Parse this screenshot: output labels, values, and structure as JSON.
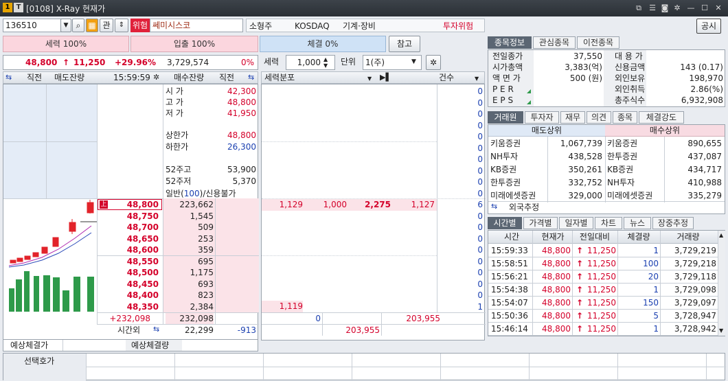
{
  "window": {
    "badge1": "1",
    "badge2": "T",
    "title": "[0108] X-Ray 현재가"
  },
  "toolbar": {
    "code": "136510",
    "gwan": "관",
    "warn_badge": "위험",
    "stock_name": "쎄미시스코",
    "gongsi": "공시"
  },
  "info": {
    "size": "소형주",
    "market": "KOSDAQ",
    "sector": "기계·장비",
    "risk": "투자위험"
  },
  "bars": {
    "sell_strength": "세력 100%",
    "inflow": "입출 100%",
    "exec": "체결 0%",
    "ref_btn": "참고"
  },
  "price": {
    "current": "48,800",
    "arrow": "↑",
    "change": "11,250",
    "rate": "+29.96%",
    "volume": "3,729,574",
    "pct": "0%"
  },
  "controls": {
    "label_force": "세력",
    "force_val": "1,000",
    "label_unit": "단위",
    "unit_val": "1(주)"
  },
  "book_header": {
    "c1": "직전",
    "c2": "매도잔량",
    "time": "15:59:59",
    "c3": "매수잔량",
    "c4": "직전"
  },
  "mid_header": {
    "force_dist": "세력분포",
    "count": "건수"
  },
  "info_labels": [
    {
      "label": "시 가",
      "value": "42,300"
    },
    {
      "label": "고 가",
      "value": "48,800"
    },
    {
      "label": "저 가",
      "value": "41,950"
    },
    {
      "label": "상한가",
      "value": "48,800"
    },
    {
      "label": "하한가",
      "value": "26,300"
    },
    {
      "label": "52주고",
      "value": "53,900"
    },
    {
      "label": "52주저",
      "value": "5,370"
    }
  ],
  "credit": {
    "prefix": "일반(",
    "val": "100",
    "suffix": ")/신용불가"
  },
  "bid_rows": [
    {
      "price": "48,800",
      "qty": "223,662"
    },
    {
      "price": "48,750",
      "qty": "1,545"
    },
    {
      "price": "48,700",
      "qty": "509"
    },
    {
      "price": "48,650",
      "qty": "253"
    },
    {
      "price": "48,600",
      "qty": "359"
    },
    {
      "price": "48,550",
      "qty": "695"
    },
    {
      "price": "48,500",
      "qty": "1,175"
    },
    {
      "price": "48,450",
      "qty": "693"
    },
    {
      "price": "48,400",
      "qty": "823"
    },
    {
      "price": "48,350",
      "qty": "2,384"
    }
  ],
  "upper_badge": "上",
  "totals": {
    "diff": "+232,098",
    "buy_total": "232,098",
    "after_label": "시간외",
    "after_qty": "22,299",
    "after_diff": "-913"
  },
  "force_row1": {
    "a": "1,129",
    "b": "1,000",
    "c": "2,275",
    "d": "1,127",
    "cnt": "6"
  },
  "force_row_last": {
    "a": "1,119",
    "cnt": "1"
  },
  "count_zero": "0",
  "force_totals": {
    "left": "0",
    "right": "203,955",
    "bottom": "203,955"
  },
  "expect": {
    "price_label": "예상체결가",
    "qty_label": "예상체결량"
  },
  "bottom": {
    "select_label": "선택호가"
  },
  "right_tabs1": [
    "종목정보",
    "관심종목",
    "이전종목"
  ],
  "stock_info": [
    {
      "l": "전일종가",
      "v": "37,550",
      "l2": "대 용 가",
      "v2": ""
    },
    {
      "l": "시가총액",
      "v": "3,383(억)",
      "l2": "신용금액",
      "v2": "143  (0.17)"
    },
    {
      "l": "액 면 가",
      "v": "500 (원)",
      "l2": "외인보유",
      "v2": "198,970"
    },
    {
      "l": "P E R",
      "v": "",
      "l2": "외인취득",
      "v2": "2.86(%)"
    },
    {
      "l": "E P S",
      "v": "",
      "l2": "총주식수",
      "v2": "6,932,908"
    }
  ],
  "right_tabs2": [
    "거래원",
    "투자자",
    "재무",
    "의견",
    "종목",
    "체결강도"
  ],
  "broker_header": {
    "sell": "매도상위",
    "buy": "매수상위"
  },
  "brokers": [
    {
      "s": "키움증권",
      "sq": "1,067,739",
      "b": "키움증권",
      "bq": "890,655"
    },
    {
      "s": "NH투자",
      "sq": "438,528",
      "b": "한투증권",
      "bq": "437,087"
    },
    {
      "s": "KB증권",
      "sq": "350,261",
      "b": "KB증권",
      "bq": "434,717"
    },
    {
      "s": "한투증권",
      "sq": "332,752",
      "b": "NH투자",
      "bq": "410,988"
    },
    {
      "s": "미래에셋증권",
      "sq": "329,000",
      "b": "미래에셋증권",
      "bq": "335,279"
    }
  ],
  "foreign_est": "외국추정",
  "right_tabs3": [
    "시간별",
    "가격별",
    "일자별",
    "차트",
    "뉴스",
    "장중추정"
  ],
  "trades_header": [
    "시간",
    "현재가",
    "전일대비",
    "체결량",
    "거래량"
  ],
  "trades": [
    {
      "t": "15:59:33",
      "p": "48,800",
      "d": "11,250",
      "q": "1",
      "v": "3,729,219"
    },
    {
      "t": "15:58:51",
      "p": "48,800",
      "d": "11,250",
      "q": "100",
      "v": "3,729,218"
    },
    {
      "t": "15:56:21",
      "p": "48,800",
      "d": "11,250",
      "q": "20",
      "v": "3,729,118"
    },
    {
      "t": "15:54:38",
      "p": "48,800",
      "d": "11,250",
      "q": "1",
      "v": "3,729,098"
    },
    {
      "t": "15:54:07",
      "p": "48,800",
      "d": "11,250",
      "q": "150",
      "v": "3,729,097"
    },
    {
      "t": "15:50:36",
      "p": "48,800",
      "d": "11,250",
      "q": "5",
      "v": "3,728,947"
    },
    {
      "t": "15:46:14",
      "p": "48,800",
      "d": "11,250",
      "q": "1",
      "v": "3,728,942"
    }
  ],
  "colors": {
    "up": "#d4002a",
    "down": "#1a3fb0",
    "bid_bg": "#fbe3e8",
    "ask_bg": "#e4ecf7"
  }
}
